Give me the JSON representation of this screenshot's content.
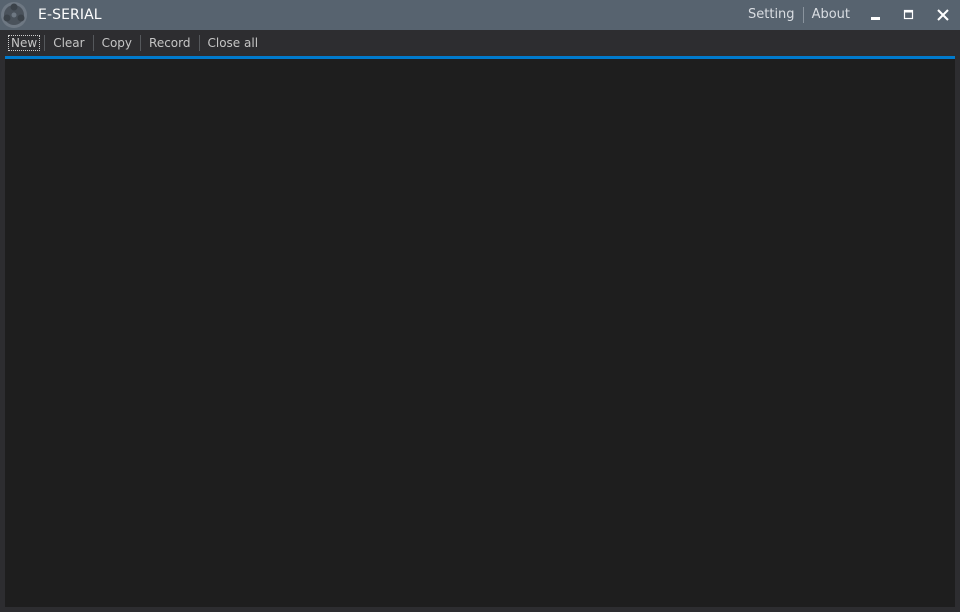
{
  "titlebar": {
    "app_title": "E-SERIAL",
    "logo_icon": "app-logo-icon",
    "links": {
      "setting": "Setting",
      "about": "About"
    },
    "window_controls": {
      "minimize_icon": "minimize-icon",
      "maximize_icon": "maximize-icon",
      "close_icon": "close-icon"
    },
    "background_color": "#57636f"
  },
  "toolbar": {
    "new_label": "New",
    "clear_label": "Clear",
    "copy_label": "Copy",
    "record_label": "Record",
    "close_all_label": "Close all"
  },
  "colors": {
    "accent": "#007acc",
    "content_background": "#1e1e1e",
    "window_background": "#2d2d30"
  }
}
